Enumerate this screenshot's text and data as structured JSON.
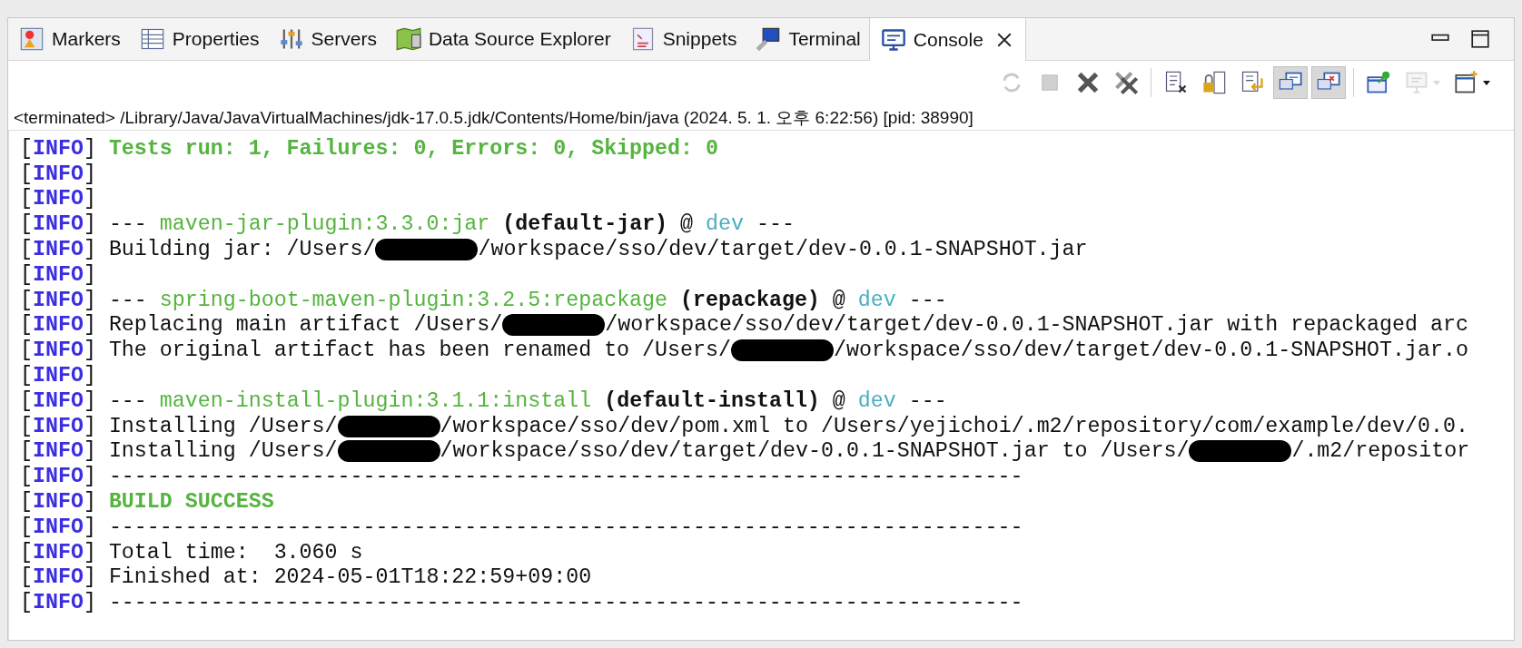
{
  "tabs": [
    {
      "label": "Markers",
      "kind": "markers",
      "selected": false
    },
    {
      "label": "Properties",
      "kind": "properties",
      "selected": false
    },
    {
      "label": "Servers",
      "kind": "servers",
      "selected": false
    },
    {
      "label": "Data Source Explorer",
      "kind": "datasource",
      "selected": false
    },
    {
      "label": "Snippets",
      "kind": "snippets",
      "selected": false
    },
    {
      "label": "Terminal",
      "kind": "terminal",
      "selected": false
    },
    {
      "label": "Console",
      "kind": "console",
      "selected": true,
      "closable": true
    }
  ],
  "toolbar": [
    {
      "kind": "sync",
      "disabled": true,
      "pressed": false
    },
    {
      "kind": "stop",
      "disabled": true,
      "pressed": false
    },
    {
      "kind": "remove",
      "disabled": false,
      "pressed": false
    },
    {
      "kind": "remove-all",
      "disabled": false,
      "pressed": false,
      "separator_after": true
    },
    {
      "kind": "clear",
      "disabled": false,
      "pressed": false
    },
    {
      "kind": "scroll-lock",
      "disabled": false,
      "pressed": false
    },
    {
      "kind": "word-wrap",
      "disabled": false,
      "pressed": false
    },
    {
      "kind": "stdout",
      "disabled": false,
      "pressed": true
    },
    {
      "kind": "stderr",
      "disabled": false,
      "pressed": true,
      "separator_after": true
    },
    {
      "kind": "pin",
      "disabled": false,
      "pressed": false
    },
    {
      "kind": "display",
      "disabled": true,
      "pressed": false,
      "dropdown": true
    },
    {
      "kind": "new-console",
      "disabled": false,
      "pressed": false,
      "dropdown": true
    }
  ],
  "process_line": "<terminated> /Library/Java/JavaVirtualMachines/jdk-17.0.5.jdk/Contents/Home/bin/java (2024. 5. 1. 오후 6:22:56) [pid: 38990]",
  "console_lines": [
    {
      "tag": "[**INFO**]",
      "segments": [
        {
          "text": "Tests run: 1, Failures: 0, Errors: 0, Skipped: 0",
          "kind": "success"
        }
      ]
    },
    {
      "tag": "[**INFO**]"
    },
    {
      "tag": "[**INFO**]"
    },
    {
      "tag": "[**INFO**]",
      "segments": [
        {
          "text": "---",
          "kind": "plain"
        },
        {
          "text": "maven-jar-plugin:3.3.0:jar",
          "kind": "plugin"
        },
        {
          "text": "(default-jar)",
          "kind": "execution"
        },
        {
          "text": "@",
          "kind": "plain"
        },
        {
          "text": "dev",
          "kind": "project"
        },
        {
          "text": "---",
          "kind": "plain"
        }
      ]
    },
    {
      "tag": "[**INFO**]",
      "segments": [
        {
          "text": "Building jar: /Users/",
          "kind": "plain"
        },
        {
          "kind": "redacted"
        },
        {
          "text": "/workspace/sso/dev/target/dev-0.0.1-SNAPSHOT.jar",
          "kind": "plain"
        }
      ]
    },
    {
      "tag": "[**INFO**]"
    },
    {
      "tag": "[**INFO**]",
      "segments": [
        {
          "text": "---",
          "kind": "plain"
        },
        {
          "text": "spring-boot-maven-plugin:3.2.5:repackage",
          "kind": "plugin"
        },
        {
          "text": "(repackage)",
          "kind": "execution"
        },
        {
          "text": "@",
          "kind": "plain"
        },
        {
          "text": "dev",
          "kind": "project"
        },
        {
          "text": "---",
          "kind": "plain"
        }
      ]
    },
    {
      "tag": "[**INFO**]",
      "segments": [
        {
          "text": "Replacing main artifact /Users/",
          "kind": "plain"
        },
        {
          "kind": "redacted"
        },
        {
          "text": "/workspace/sso/dev/target/dev-0.0.1-SNAPSHOT.jar with repackaged arc",
          "kind": "plain"
        }
      ]
    },
    {
      "tag": "[**INFO**]",
      "segments": [
        {
          "text": "The original artifact has been renamed to /Users/",
          "kind": "plain"
        },
        {
          "kind": "redacted"
        },
        {
          "text": "/workspace/sso/dev/target/dev-0.0.1-SNAPSHOT.jar.o",
          "kind": "plain"
        }
      ]
    },
    {
      "tag": "[**INFO**]"
    },
    {
      "tag": "[**INFO**]",
      "segments": [
        {
          "text": "---",
          "kind": "plain"
        },
        {
          "text": "maven-install-plugin:3.1.1:install",
          "kind": "plugin"
        },
        {
          "text": "(default-install)",
          "kind": "execution"
        },
        {
          "text": "@",
          "kind": "plain"
        },
        {
          "text": "dev",
          "kind": "project"
        },
        {
          "text": "---",
          "kind": "plain"
        }
      ]
    },
    {
      "tag": "[**INFO**]",
      "segments": [
        {
          "text": "Installing /Users/",
          "kind": "plain"
        },
        {
          "kind": "redacted"
        },
        {
          "text": "/workspace/sso/dev/pom.xml to /Users/yejichoi/.m2/repository/com/example/dev/0.0.",
          "kind": "plain"
        }
      ]
    },
    {
      "tag": "[**INFO**]",
      "segments": [
        {
          "text": "Installing /Users/",
          "kind": "plain"
        },
        {
          "kind": "redacted"
        },
        {
          "text": "/workspace/sso/dev/target/dev-0.0.1-SNAPSHOT.jar to /Users/",
          "kind": "plain"
        },
        {
          "kind": "redacted"
        },
        {
          "text": "/.m2/repositor",
          "kind": "plain"
        }
      ]
    },
    {
      "tag": "[**INFO**]",
      "segments": [
        {
          "text": "------------------------------------------------------------------------",
          "kind": "plain"
        }
      ]
    },
    {
      "tag": "[**INFO**]",
      "segments": [
        {
          "text": "BUILD SUCCESS",
          "kind": "success"
        }
      ]
    },
    {
      "tag": "[**INFO**]",
      "segments": [
        {
          "text": "------------------------------------------------------------------------",
          "kind": "plain"
        }
      ]
    },
    {
      "tag": "[**INFO**]",
      "segments": [
        {
          "text": "Total time:  3.060 s",
          "kind": "plain"
        }
      ]
    },
    {
      "tag": "[**INFO**]",
      "segments": [
        {
          "text": "Finished at: 2024-05-01T18:22:59+09:00",
          "kind": "plain"
        }
      ]
    },
    {
      "tag": "[**INFO**]",
      "segments": [
        {
          "text": "------------------------------------------------------------------------",
          "kind": "plain"
        }
      ]
    }
  ]
}
